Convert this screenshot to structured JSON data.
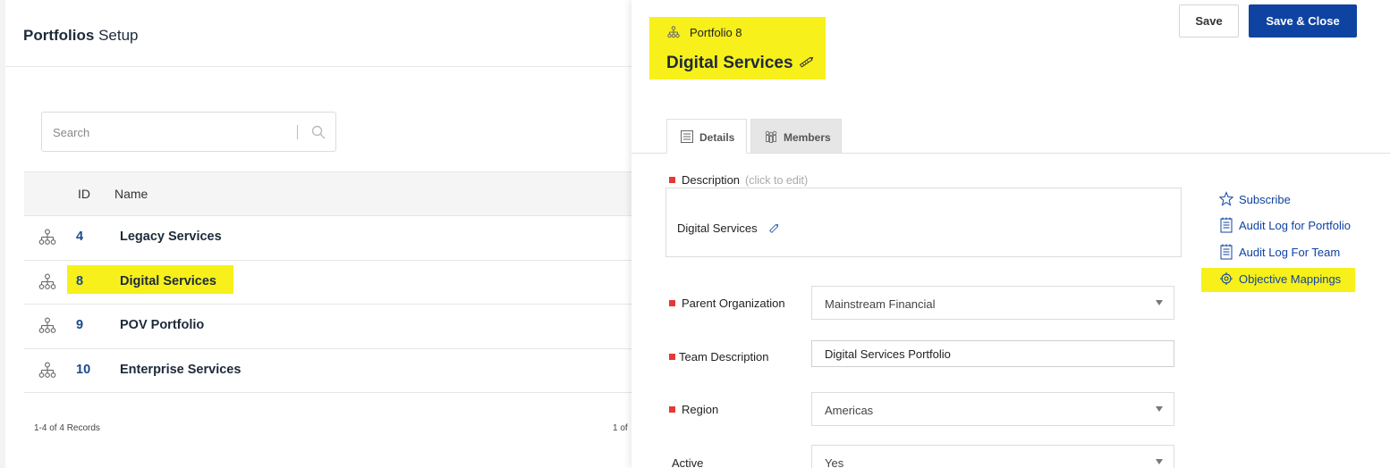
{
  "left": {
    "title_bold": "Portfolios",
    "title_rest": " Setup",
    "search_placeholder": "Search",
    "columns": {
      "id": "ID",
      "name": "Name"
    },
    "rows": [
      {
        "id": "4",
        "name": "Legacy Services",
        "selected": false
      },
      {
        "id": "8",
        "name": "Digital Services",
        "selected": true
      },
      {
        "id": "9",
        "name": "POV Portfolio",
        "selected": false
      },
      {
        "id": "10",
        "name": "Enterprise Services",
        "selected": false
      }
    ],
    "records_text": "1-4 of 4 Records",
    "page_text": "1 of"
  },
  "right": {
    "portfolio_label": "Portfolio 8",
    "portfolio_name": "Digital Services",
    "save_label": "Save",
    "save_close_label": "Save & Close",
    "tabs": {
      "details": "Details",
      "members": "Members"
    },
    "description_label": "Description",
    "description_hint": "(click to edit)",
    "description_value": "Digital Services",
    "parent_org_label": "Parent Organization",
    "parent_org_value": "Mainstream Financial",
    "team_desc_label": "Team Description",
    "team_desc_value": "Digital Services Portfolio",
    "region_label": "Region",
    "region_value": "Americas",
    "active_label": "Active",
    "active_value": "Yes",
    "links": {
      "subscribe": "Subscribe",
      "audit_portfolio": "Audit Log for Portfolio",
      "audit_team": "Audit Log For Team",
      "objective_mappings": "Objective Mappings"
    }
  },
  "colors": {
    "highlight": "#f7f01a",
    "primary": "#0f43a1",
    "required": "#e53935",
    "link": "#0f43a1"
  }
}
